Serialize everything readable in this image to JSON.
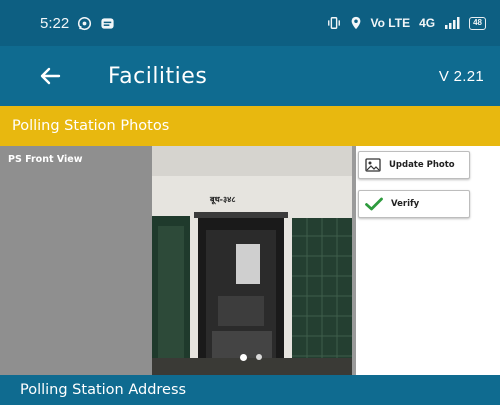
{
  "status_bar": {
    "time": "5:22",
    "network_label": "Vo LTE",
    "signal_label": "4G",
    "battery": "48"
  },
  "app_bar": {
    "title": "Facilities",
    "version": "V 2.21"
  },
  "section": {
    "title": "Polling Station Photos"
  },
  "photo_panel": {
    "label": "PS Front View",
    "wall_text": "बूथ-३४८",
    "carousel_dots": 2,
    "active_dot": 0
  },
  "actions": {
    "update_label": "Update Photo",
    "verify_label": "Verify"
  },
  "next_section": {
    "title": "Polling Station Address"
  },
  "colors": {
    "status_bar": "#0d5f82",
    "app_bar": "#0f6b90",
    "accent_yellow": "#e8b80f",
    "verify_green": "#2e9b3e"
  }
}
